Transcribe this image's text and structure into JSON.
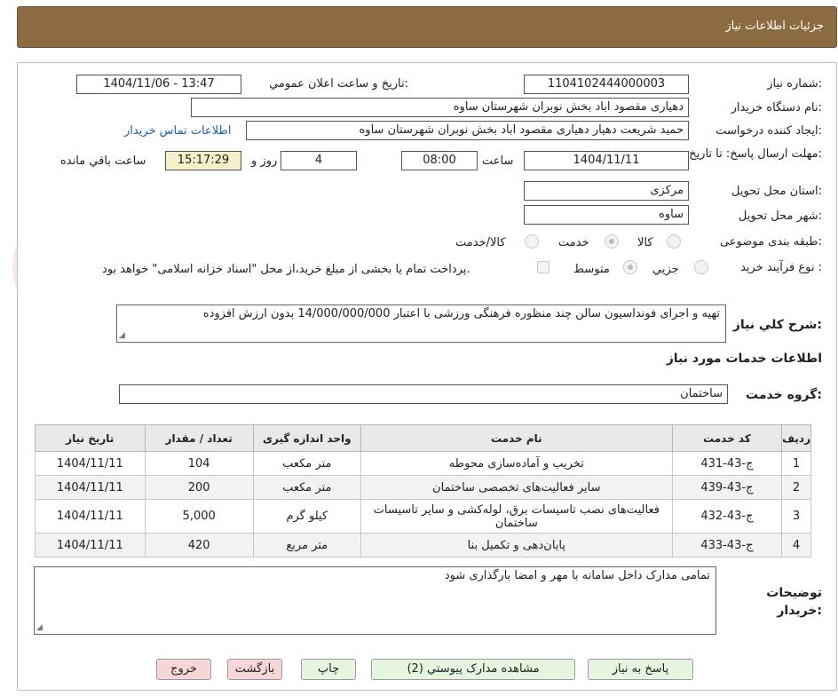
{
  "header": {
    "title": "جزئیات اطلاعات نیاز"
  },
  "form": {
    "need_number_label": "شماره نیاز:",
    "need_number": "1104102444000003",
    "announce_label": "تاریخ و ساعت اعلان عمومي:",
    "announce_value": "1404/11/06 - 13:47",
    "buyer_org_label": "نام دستگاه خریدار:",
    "buyer_org": "دهیاری مقصود اباد بخش نوبران شهرستان ساوه",
    "requester_label": "ایجاد کننده درخواست:",
    "requester": "حمید شریعت دهیار دهیاری مقصود اباد بخش نوبران شهرستان ساوه",
    "contact_link": "اطلاعات تماس خریدار",
    "deadline_label": "مهلت ارسال پاسخ: تا تاریخ:",
    "deadline_date": "1404/11/11",
    "time_label": "ساعت",
    "deadline_time": "08:00",
    "days_value": "4",
    "days_label": "روز و",
    "remaining_time": "15:17:29",
    "remaining_label": "ساعت باقي مانده",
    "province_label": "استان محل تحویل:",
    "province": "مرکزی",
    "city_label": "شهر محل تحویل:",
    "city": "ساوه",
    "category_label": "طبقه بندی موضوعی:",
    "category_options": [
      "کالا",
      "خدمت",
      "کالا/خدمت"
    ],
    "process_label": "نوع فرآیند خرید :",
    "process_options": [
      "جزیي",
      "متوسط"
    ],
    "payment_note": "پرداخت تمام یا بخشی از مبلغ خرید،از محل \"اسناد خزانه اسلامی\" خواهد بود.",
    "description_label": "شرح کلي نیاز:",
    "description": "تهیه و اجرای فونداسیون سالن چند منظوره فرهنگی ورزشی با اعتبار 14/000/000/000 بدون ارزش افزوده",
    "services_heading": "اطلاعات خدمات مورد نیاز",
    "service_group_label": "گروه خدمت:",
    "service_group": "ساختمان",
    "buyer_notes_label": "توضیحات خریدار:",
    "buyer_notes": "تمامی مدارک داخل سامانه با مهر و امضا بارگذاری شود"
  },
  "table": {
    "headers": [
      "ردیف",
      "کد خدمت",
      "نام خدمت",
      "واحد اندازه گیری",
      "تعداد / مقدار",
      "تاریخ نیاز"
    ],
    "rows": [
      {
        "idx": "1",
        "code": "ج-43-431",
        "name": "تخریب و آماده‌سازی محوطه",
        "unit": "متر مکعب",
        "qty": "104",
        "date": "1404/11/11"
      },
      {
        "idx": "2",
        "code": "ج-43-439",
        "name": "سایر فعالیت‌های تخصصی ساختمان",
        "unit": "متر مکعب",
        "qty": "200",
        "date": "1404/11/11"
      },
      {
        "idx": "3",
        "code": "ج-43-432",
        "name": "فعالیت‌های نصب تاسیسات برق، لوله‌کشی و سایر تاسیسات ساختمان",
        "unit": "کیلو گرم",
        "qty": "5,000",
        "date": "1404/11/11"
      },
      {
        "idx": "4",
        "code": "ج-43-433",
        "name": "پایان‌دهی و تکمیل بنا",
        "unit": "متر مربع",
        "qty": "420",
        "date": "1404/11/11"
      }
    ]
  },
  "buttons": {
    "reply": "پاسخ به نیاز",
    "attachments": "مشاهده مدارک پیوستي (2)",
    "print": "چاپ",
    "back": "بازگشت",
    "exit": "خروج"
  },
  "colors": {
    "header_bg": "#8b6b3f",
    "link": "#1a5fb4",
    "remaining_bg": "#f5f0c8"
  }
}
